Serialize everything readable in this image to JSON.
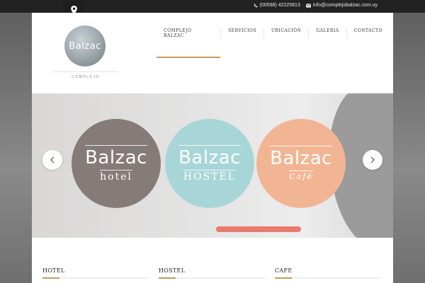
{
  "topbar": {
    "phone": "(00598) 42225813",
    "email": "info@complejobalzac.com.uy",
    "icons": [
      "map-pin-icon",
      "phone-icon",
      "envelope-icon"
    ]
  },
  "logo": {
    "text": "Balzac",
    "subtitle": "COMPLEJO"
  },
  "nav": {
    "items": [
      {
        "label": "COMPLEJO BALZAC",
        "active": true
      },
      {
        "label": "SERVICIOS"
      },
      {
        "label": "UBICACIÓN"
      },
      {
        "label": "GALERIA"
      },
      {
        "label": "CONTACTO"
      }
    ]
  },
  "slider": {
    "brands": [
      {
        "name": "Balzac",
        "sub": "hotel",
        "color": "#857b78"
      },
      {
        "name": "Balzac",
        "sub": "HOSTEL",
        "color": "#a8d6d8"
      },
      {
        "name": "Balzac",
        "sub": "Café",
        "color": "#f2b593"
      }
    ],
    "prev_icon": "chevron-left-icon",
    "next_icon": "chevron-right-icon"
  },
  "sections": [
    {
      "title": "HOTEL"
    },
    {
      "title": "HOSTEL"
    },
    {
      "title": "CAFE"
    }
  ],
  "colors": {
    "accent": "#c49a5b",
    "topbar": "#222222"
  }
}
